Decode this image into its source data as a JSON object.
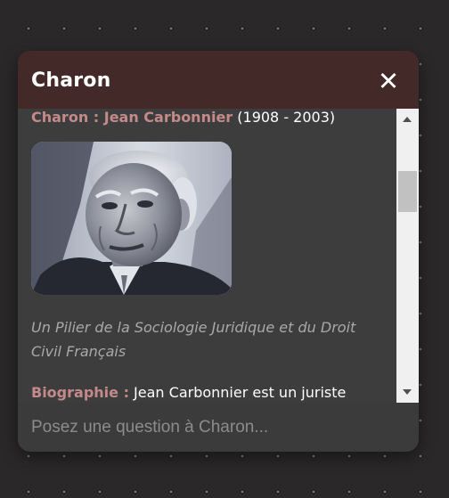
{
  "chat": {
    "title": "Charon",
    "close_icon": "close-icon"
  },
  "message": {
    "name_label": "Charon : Jean Carbonnier",
    "dates": " (1908 - 2003)",
    "photo": "portrait-photo",
    "subtitle": "Un Pilier de la Sociologie Juridique et du Droit Civil Français",
    "bio_label": "Biographie :",
    "bio_text": " Jean Carbonnier est un juriste"
  },
  "input": {
    "placeholder": "Posez une question à Charon..."
  },
  "colors": {
    "header": "#432a28",
    "accent": "#c48a8a",
    "panel": "#3c3c3c"
  }
}
